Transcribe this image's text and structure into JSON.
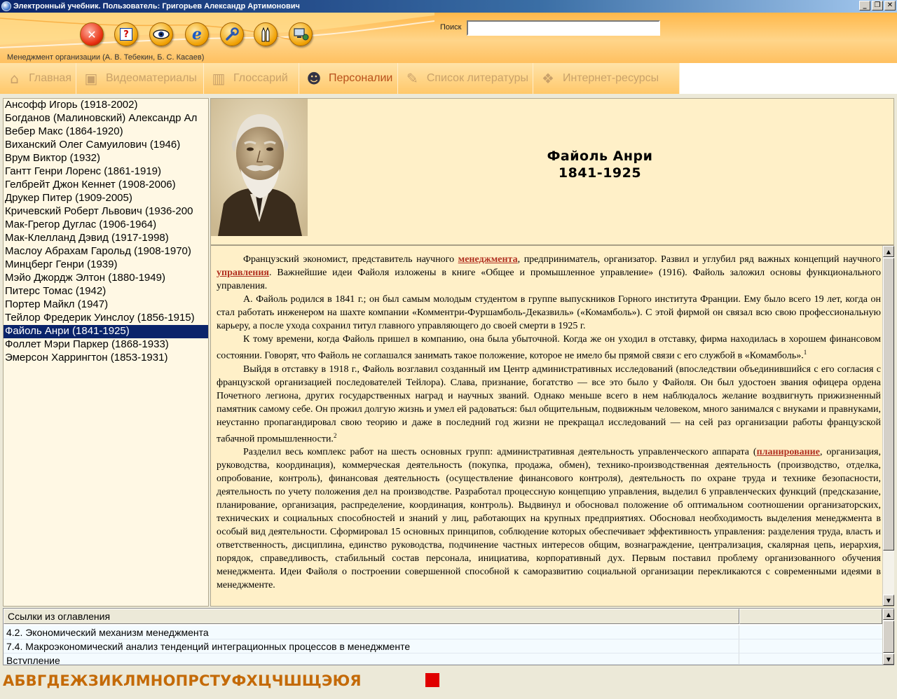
{
  "window": {
    "title": "Электронный учебник. Пользователь: Григорьев Александр Артимонович",
    "minimize": "_",
    "maximize": "❐",
    "close": "✕"
  },
  "header": {
    "search_label": "Поиск",
    "search_value": "",
    "book_title": "Менеджмент организации (А. В. Тебекин, Б. С. Касаев)",
    "colors": {
      "accent": "#ffb84a",
      "selected": "#0a246a",
      "link": "#b03020",
      "alphabet": "#c46a08"
    }
  },
  "toolbar": {
    "icons": [
      "close-icon",
      "help-icon",
      "eye-icon",
      "internet-explorer-icon",
      "wrench-icon",
      "pens-icon",
      "network-icon"
    ]
  },
  "nav": {
    "tabs": [
      {
        "label": "Главная",
        "icon": "home-icon"
      },
      {
        "label": "Видеоматериалы",
        "icon": "video-icon"
      },
      {
        "label": "Глоссарий",
        "icon": "books-icon"
      },
      {
        "label": "Персоналии",
        "icon": "person-icon",
        "active": true
      },
      {
        "label": "Список литературы",
        "icon": "pen-paper-icon"
      },
      {
        "label": "Интернет-ресурсы",
        "icon": "globe-box-icon"
      }
    ]
  },
  "persons": [
    "Ансофф Игорь  (1918-2002)",
    "Богданов (Малиновский) Александр Ал",
    "Вебер Макс  (1864-1920)",
    "Виханский Олег Самуилович (1946)",
    "Врум Виктор  (1932)",
    "Гантт Генри Лоренс (1861-1919)",
    "Гелбрейт Джон Кеннет  (1908-2006)",
    "Друкер Питер  (1909-2005)",
    "Кричевский Роберт Львович (1936-200",
    "Мак-Грегор Дуглас  (1906-1964)",
    "Мак-Клелланд Дэвид  (1917-1998)",
    "Маслоу Абрахам Гарольд (1908-1970)",
    "Минцберг Генри  (1939)",
    "Мэйо Джордж Элтон (1880-1949)",
    "Питерс Томас  (1942)",
    "Портер Майкл  (1947)",
    "Тейлор Фредерик Уинслоу (1856-1915)",
    "Файоль Анри  (1841-1925)",
    "Фоллет Мэри Паркер (1868-1933)",
    "Эмерсон Харрингтон  (1853-1931)"
  ],
  "selected_person_index": 17,
  "person": {
    "name": "Файоль Анри",
    "years": "1841-1925",
    "bio": {
      "p1_a": "Французский экономист, представитель научного ",
      "p1_link1": "менеджмента",
      "p1_b": ", предприниматель, организатор. Развил и углубил ряд важных концепций научного ",
      "p1_link2": "управления",
      "p1_c": ". Важнейшие идеи Файоля изложены в книге «Общее и промышленное управление» (1916). Файоль заложил основы функционального управления.",
      "p2": "А. Файоль родился в 1841 г.; он был самым молодым студентом в группе выпускников Горного института Франции. Ему было всего 19 лет, когда он стал работать инженером на шахте компании «Комментри-Фуршамболь-Деказвиль» («Комамболь»). С этой фирмой он связал всю свою профессиональную карьеру, а после ухода сохранил титул главного управляющего до своей смерти в 1925 г.",
      "p3": "К тому времени, когда Файоль пришел в компанию, она была убыточной. Когда же он уходил в отставку, фирма находилась в хорошем финансовом состоянии. Говорят, что Файоль не соглашался занимать такое положение, которое не имело бы прямой связи с его службой в «Комамболь».",
      "p3_sup": "1",
      "p4": "Выйдя в отставку в 1918 г., Файоль возглавил созданный им Центр административных исследований (впоследствии объединившийся с его согласия с французской организацией последователей Тейлора). Слава, признание, богатство — все это было у Файоля. Он был удостоен звания офицера ордена Почетного легиона, других государственных наград и научных званий. Однако меньше всего в нем наблюдалось желание воздвигнуть прижизненный памятник самому себе. Он прожил долгую жизнь и умел ей радоваться: был общительным, подвижным человеком, много занимался с внуками и правнуками, неустанно пропагандировал свою теорию и даже в последний год жизни не прекращал исследований — на сей раз организации работы французской табачной промышленности.",
      "p4_sup": "2",
      "p5_a": "Разделил весь комплекс работ на шесть основных групп: административная деятельность управленческого аппарата (",
      "p5_link": "планирование",
      "p5_b": ", организация, руководства, координация), коммерческая деятельность (покупка, продажа, обмен), технико-производственная деятельность (производство, отделка, опробование, контроль), финансовая деятельность (осуществление финансового контроля), деятельность по охране труда и технике безопасности, деятельность по учету положения дел на производстве. Разработал процессную концепцию управления, выделил 6 управленческих функций (предсказание, планирование, организация, распределение, координация, контроль). Выдвинул и обосновал положение об оптимальном соотношении организаторских, технических и социальных способностей и знаний у лиц, работающих на крупных предприятиях. Обосновал необходимость выделения менеджмента в особый вид деятельности. Сформировал 15 основных принципов, соблюдение которых обеспечивает эффективность управления: разделения труда, власть и ответственность, дисциплина, единство руководства, подчинение частных интересов общим, вознаграждение, централизация, скалярная цепь, иерархия, порядок, справедливость, стабильный состав персонала, инициатива, корпоративный дух. Первым поставил проблему организованного обучения менеджмента. Идеи Файоля о построении совершенной способной к саморазвитию социальной организации перекликаются с современными идеями в менеджменте."
    }
  },
  "links": {
    "header": "Ссылки из оглавления",
    "rows": [
      "4.2. Экономический механизм менеджмента",
      "7.4. Макроэкономический анализ тенденций интеграционных процессов в менеджменте",
      "Вступление"
    ]
  },
  "alphabet": "АБВГДЕЖЗИКЛМНОПРСТУФХЦЧШЩЭЮЯ"
}
